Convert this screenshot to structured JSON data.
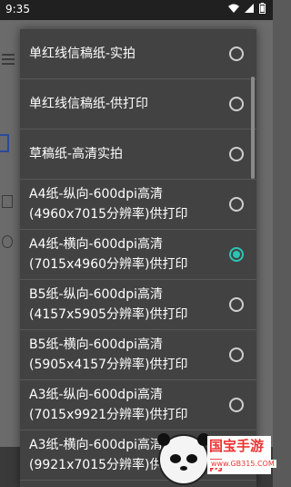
{
  "status_bar": {
    "time": "9:35"
  },
  "dialog": {
    "options": [
      {
        "label": "单红线信稿纸-实拍",
        "selected": false
      },
      {
        "label": "单红线信稿纸-供打印",
        "selected": false
      },
      {
        "label": "草稿纸-高清实拍",
        "selected": false
      },
      {
        "label": "A4纸-纵向-600dpi高清\n(4960x7015分辨率)供打印",
        "selected": false
      },
      {
        "label": "A4纸-横向-600dpi高清\n(7015x4960分辨率)供打印",
        "selected": true
      },
      {
        "label": "B5纸-纵向-600dpi高清\n(4157x5905分辨率)供打印",
        "selected": false
      },
      {
        "label": "B5纸-横向-600dpi高清\n(5905x4157分辨率)供打印",
        "selected": false
      },
      {
        "label": "A3纸-纵向-600dpi高清\n(7015x9921分辨率)供打印",
        "selected": false
      },
      {
        "label": "A3纸-横向-600dpi高清\n(9921x7015分辨率)供打印",
        "selected": false
      }
    ]
  },
  "watermark": {
    "brand": "国宝手游网",
    "url": "www.GB315.COM"
  },
  "colors": {
    "accent": "#2bc4b4",
    "dialog_bg": "#424242"
  }
}
